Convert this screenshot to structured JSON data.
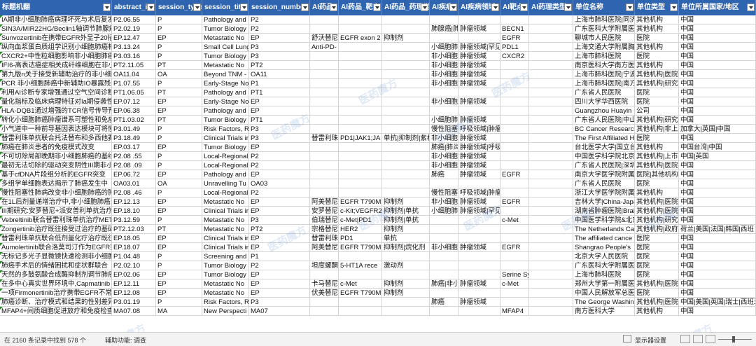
{
  "columns": [
    "标题机翻",
    "abstract_id",
    "session_type",
    "session_title",
    "session_number",
    "AI药品",
    "AI药品_靶点",
    "AI药品_药理类型",
    "AI疾病",
    "AI疾病领域",
    "AI靶点",
    "AI药理类型",
    "单位名称",
    "单位类型",
    "单位所属国家/地区"
  ],
  "rows": [
    [
      "IA期非小细胞肺癌病理坏死与术后复发",
      "P2.06.55",
      "P",
      "Pathology and",
      "P2",
      "",
      "",
      "",
      "",
      "",
      "",
      "",
      "上海市肺科医院|同济",
      "其他机构",
      "中国"
    ],
    [
      "SIN3A/MIR22HG/Beclin1轴调节肺腺癌",
      "P2.02.19",
      "P",
      "Tumor Biology",
      "P2",
      "",
      "",
      "",
      "肺腺癌|肺",
      "肿瘤领域",
      "BECN1",
      "",
      "广东医科大学附属医院",
      "其他机构",
      "中国"
    ],
    [
      "Sunvozertinib在携带EGFR外显子20插入",
      "EP.12.47",
      "EP",
      "Metastatic No",
      "EP",
      "舒沃替尼",
      "EGFR exon 2",
      "抑制剂",
      "",
      "",
      "EGFR",
      "",
      "聊城市人民医院",
      "医院",
      "中国"
    ],
    [
      "纵向血浆蛋白质组学识别小细胞肺癌相关",
      "P3.13.24",
      "P",
      "Small Cell Lung",
      "P3",
      "Anti-PD-",
      "",
      "",
      "小细胞肺",
      "肿瘤领域|罕见",
      "PDL1",
      "",
      "上海交通大学附属胸科",
      "其他机构",
      "中国"
    ],
    [
      "CXCR2+中性粒细胞影响非小细胞肺癌",
      "P3.03.16",
      "P",
      "Tumor Biology",
      "P3",
      "",
      "",
      "",
      "非小细胞",
      "肿瘤领域",
      "CXCR2",
      "",
      "上海市肺科医院",
      "医院",
      "中国"
    ],
    [
      "IFI6-高表达癌症相关成纤维细胞在非小",
      "PT2.11.05",
      "PT",
      "Metastatic No",
      "PT2",
      "",
      "",
      "",
      "非小细胞",
      "肿瘤领域",
      "",
      "",
      "南京医科大学南方医院",
      "其他机构",
      "中国"
    ],
    [
      "第九版n关于接受新辅助治疗的非小细胞",
      "OA11.04",
      "OA",
      "Beyond TNM -",
      "OA11",
      "",
      "",
      "",
      "非小细胞",
      "肿瘤领域",
      "",
      "",
      "上海市肺科医院|宁波",
      "其他机构|医院",
      "中国"
    ],
    [
      "PCR 非小细胞肺癌中新辅助IO暴露残留",
      "P1.07.55",
      "P",
      "Early-Stage No",
      "P1",
      "",
      "",
      "",
      "非小细胞",
      "肿瘤领域",
      "",
      "",
      "上海市肺科医院|南方",
      "其他机构|研究机",
      "中国"
    ],
    [
      "利用AI诊断专家增强通过空气空间诊断",
      "PT1.06.05",
      "PT",
      "Pathology and",
      "PT1",
      "",
      "",
      "",
      "",
      "",
      "",
      "",
      "广东省人民医院",
      "医院",
      "中国"
    ],
    [
      "量化指标及临床病理特征对Ia期侵袭性",
      "EP.07.12",
      "EP",
      "Early-Stage No",
      "EP",
      "",
      "",
      "",
      "非小细胞",
      "肿瘤领域",
      "",
      "",
      "四川大学华西医院",
      "医院",
      "中国"
    ],
    [
      "HLA-DQB1通过增强的TCR信号传导预测",
      "EP.06.38",
      "EP",
      "Pathology and",
      "EP",
      "",
      "",
      "",
      "",
      "",
      "",
      "",
      "Guangzhou Huayin",
      "公司",
      "中国"
    ],
    [
      "转化小细胞肺癌肿瘤谱系可塑性和免疫",
      "PT1.03.02",
      "PT",
      "Tumor Biology",
      "PT1",
      "",
      "",
      "",
      "小细胞肺",
      "肿瘤领域",
      "",
      "",
      "广东省人民医院|中山",
      "其他机构|研究机",
      "中国"
    ],
    [
      "小气道中一种前导基因表达模块可将慢性",
      "P3.01.49",
      "P",
      "Risk Factors, R",
      "P3",
      "",
      "",
      "",
      "慢性阻塞",
      "呼吸领域|肿瘤",
      "",
      "",
      "BC Cancer Research",
      "其他机构|非上",
      "加拿大|英国|中国"
    ],
    [
      "替雷利珠单抗联合托法替布和多西他赛",
      "P3.18.49",
      "P",
      "Clinical Trials in",
      "P3",
      "替雷利珠",
      "PD1|JAK1;JA",
      "单抗|抑制剂|紫杉",
      "非小细胞",
      "肿瘤领域",
      "",
      "",
      "The First Affiliated H",
      "医院",
      "中国"
    ],
    [
      "肺癌在肺炎患者的免疫模式改变",
      "EP.03.17",
      "EP",
      "Tumor Biology",
      "EP",
      "",
      "",
      "",
      "肺癌|肺炎",
      "肿瘤领域|呼吸",
      "",
      "",
      "台北医学大学|国立台",
      "其他机构",
      "中国台湾|中国"
    ],
    [
      "不可切除局部晚期非小细胞肺癌的基线",
      "P2.08 .55",
      "P",
      "Local-Regional",
      "P2",
      "",
      "",
      "",
      "非小细胞",
      "肿瘤领域",
      "",
      "",
      "中国医学科学院北京",
      "其他机构|上市",
      "中国|英国"
    ],
    [
      "最初无法切除的驱动突变阴性III期非小细",
      "P2.08 .09",
      "P",
      "Local-Regional",
      "P2",
      "",
      "",
      "",
      "非小细胞",
      "肿瘤领域",
      "",
      "",
      "广东省人民医院|深圳",
      "其他机构|医院",
      "中国"
    ],
    [
      "基于cfDNA片段组分析的EGFR突变",
      "EP.06.72",
      "EP",
      "Pathology and",
      "EP",
      "",
      "",
      "",
      "肺癌",
      "肿瘤领域",
      "EGFR",
      "",
      "南京大学医学院附属",
      "医院|其他机构",
      "中国"
    ],
    [
      "多组学单细胞表达揭示了肺癌发生中",
      "OA03.01",
      "OA",
      "Unravelling Tu",
      "OA03",
      "",
      "",
      "",
      "",
      "",
      "",
      "",
      "广东省人民医院",
      "医院",
      "中国"
    ],
    [
      "慢性阻塞性肺病改变非小细胞肺癌的肿",
      "P2.08 .46",
      "P",
      "Local-Regional",
      "P2",
      "",
      "",
      "",
      "慢性阻塞",
      "呼吸领域|肿瘤",
      "",
      "",
      "浙江大学医学院附属",
      "其他机构",
      "中国"
    ],
    [
      "在1L后剂量递增治疗中,非小细胞肺癌患",
      "EP.12.13",
      "EP",
      "Metastatic No",
      "EP",
      "阿美替尼",
      "EGFR T790M",
      "抑制剂",
      "非小细胞",
      "肿瘤领域",
      "EGFR",
      "",
      "吉林大学|China-Japa",
      "其他机构|医院",
      "中国"
    ],
    [
      "III期研究:安罗替尼+派安普利单抗治疗",
      "EP.18.10",
      "EP",
      "Clinical Trials in",
      "EP",
      "安罗替尼",
      "c-Kit;VEGFR2",
      "抑制剂|单抗",
      "小细胞肺",
      "肿瘤领域|罕见",
      "",
      "",
      "湖南省肿瘤医院|Brair",
      "其他机构|医院",
      "中国"
    ],
    [
      "Vebreltinib联合替雷利珠单抗治疗MET",
      "P3.12.59",
      "P",
      "Metastatic No",
      "P3",
      "伯瑞替尼",
      "c-Met|PD1",
      "抑制剂|单抗",
      "",
      "",
      "c-Met",
      "",
      "中国医学科学院&北京",
      "其他机构|研究",
      "中国"
    ],
    [
      "Zongertinib治疗既往接受过治疗的基础",
      "PT2.12.03",
      "PT",
      "Metastatic No",
      "PT2",
      "宗格替尼",
      "HER2",
      "抑制剂",
      "",
      "",
      "",
      "",
      "The Netherlands Ca",
      "其他机构|政府",
      "荷兰|美国|法国|韩国|西班"
    ],
    [
      "替雷利珠单抗联合低剂量化疗治疗既往",
      "EP.18.05",
      "EP",
      "Clinical Trials in",
      "EP",
      "替雷利珠",
      "PD1",
      "单抗",
      "",
      "",
      "",
      "",
      "The affiliated cance",
      "医院",
      "中国"
    ],
    [
      "Aumolertinib联合洛莫司汀作为EGFR突",
      "EP.18.07",
      "EP",
      "Clinical Trials in",
      "EP",
      "阿美替尼",
      "EGFR T790M",
      "抑制剂|烷化剂",
      "非小细胞",
      "肿瘤领域",
      "EGFR",
      "",
      "Shangrao People's",
      "医院",
      "中国"
    ],
    [
      "无标记多光子显微镜快速检测非小细胞",
      "P1.04.48",
      "P",
      "Screening and",
      "P1",
      "",
      "",
      "",
      "",
      "",
      "",
      "",
      "北京大学人民医院",
      "医院",
      "中国"
    ],
    [
      "肺癌手术后的情绪困扰和症状群联合",
      "P2.02.10",
      "P",
      "Tumor Biology",
      "P2",
      "坦度螺酮",
      "5-HT1A rece",
      "激动剂",
      "",
      "",
      "",
      "",
      "广东医科大学附属医院",
      "医院",
      "中国"
    ],
    [
      "天然的多鼓氨酸合成酶抑制剂调节肺癌",
      "EP.02.06",
      "EP",
      "Tumor Biology",
      "EP",
      "",
      "",
      "",
      "",
      "",
      "Serine Sy",
      "",
      "上海市肺科医院",
      "医院",
      "中国"
    ],
    [
      "在多中心真实世界环境中,Capmatinib",
      "EP.12.11",
      "EP",
      "Metastatic No",
      "EP",
      "卡马替尼",
      "c-Met",
      "抑制剂",
      "肺癌|非小",
      "肿瘤领域",
      "c-Met",
      "",
      "郑州大学第一附属医院",
      "其他机构|医院",
      "中国"
    ],
    [
      "一项Firmonertinib治疗携带EGFR不常",
      "EP.12.08",
      "EP",
      "Metastatic No",
      "EP",
      "伏美替尼",
      "EGFR T790M",
      "抑制剂",
      "",
      "",
      "",
      "",
      "中国人民解放军总医院",
      "医院",
      "中国"
    ],
    [
      "肺癌诊断、治疗模式和结果的性别差异",
      "P3.01.19",
      "P",
      "Risk Factors, R",
      "P3",
      "",
      "",
      "",
      "肺癌",
      "肿瘤领域",
      "",
      "",
      "The George Washin",
      "其他机构|医院",
      "中国|美国|英国|瑞士|西班牙"
    ],
    [
      "MFAP4+间质细胞促进放疗和免疫检查",
      "MA07.08",
      "MA",
      "New Perspecti",
      "MA07",
      "",
      "",
      "",
      "",
      "",
      "MFAP4",
      "",
      "南方医科大学",
      "其他机构",
      "中国"
    ]
  ],
  "status": {
    "record_count": "在 2160 条记录中找到 578 个",
    "accessibility": "辅助功能: 调查",
    "display_settings": "显示器设置"
  },
  "watermark": "医药魔方",
  "colors": {
    "header_bg": "#2e64b0",
    "header_text": "#ffffff",
    "grid": "#d4d4d4"
  }
}
